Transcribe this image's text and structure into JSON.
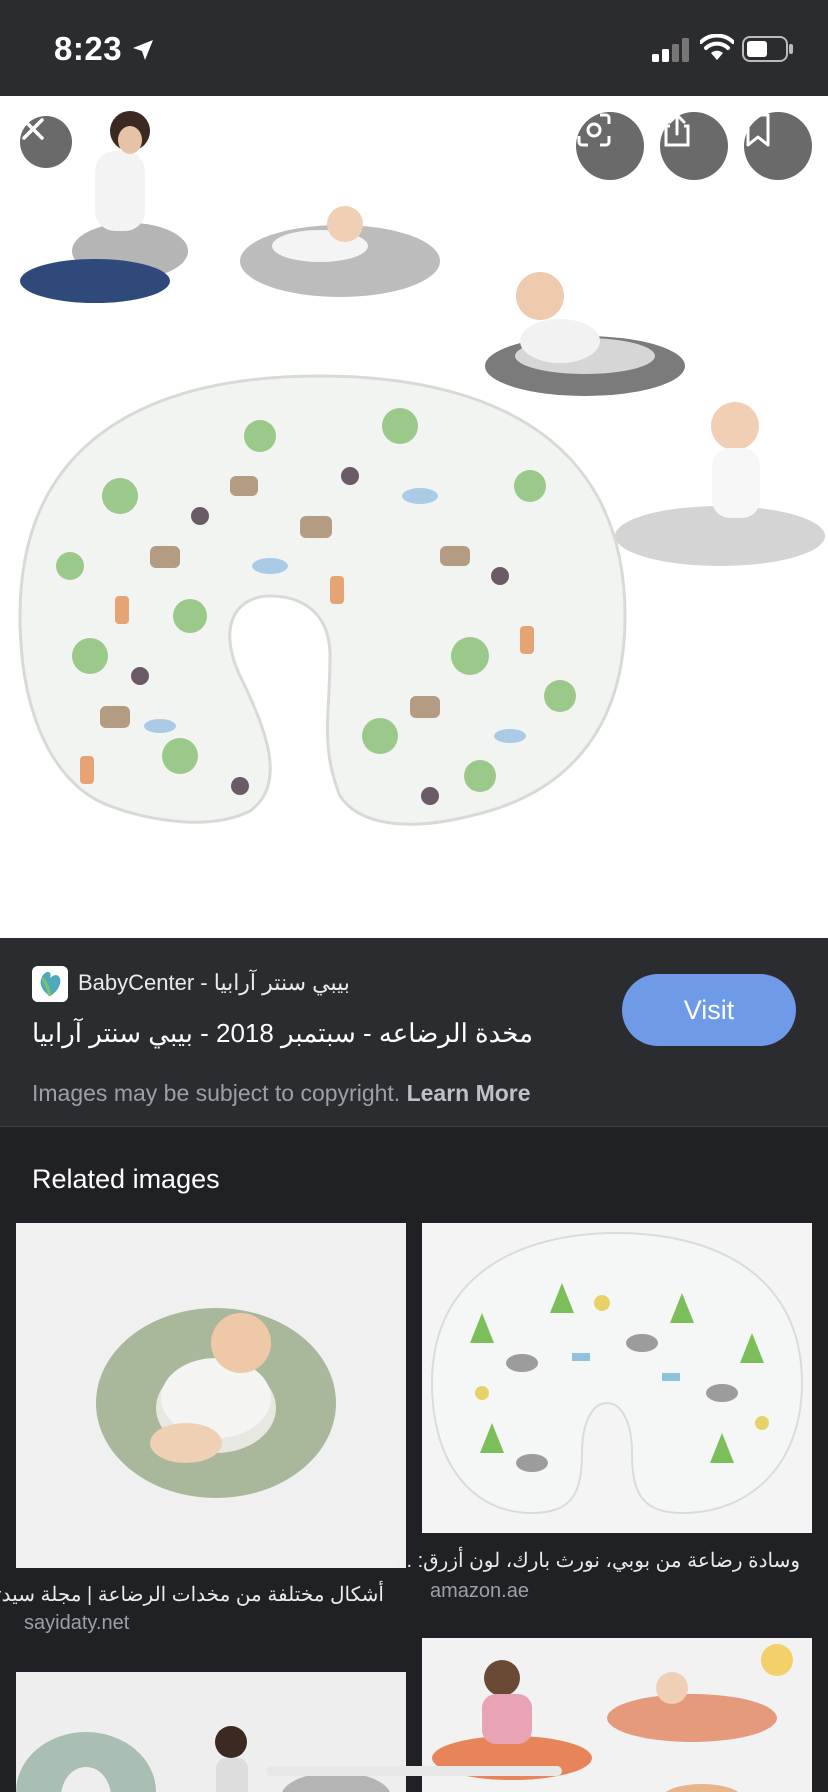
{
  "status_bar": {
    "time": "8:23"
  },
  "viewer": {
    "close_icon": "close-icon",
    "actions": [
      "lens-icon",
      "share-icon",
      "bookmark-icon"
    ]
  },
  "result": {
    "source": "BabyCenter - بيبي سنتر آرابيا",
    "title": "مخدة الرضاعه - سبتمبر 2018 - بيبي سنتر آرابيا",
    "visit_label": "Visit",
    "copyright_text": "Images may be subject to copyright.",
    "learn_more": "Learn More"
  },
  "related": {
    "heading": "Related images",
    "items": [
      {
        "caption": "أشكال مختلفة من مخدات الرضاعة | مجلة سيدتي",
        "domain": "sayidaty.net"
      },
      {
        "caption": "وسادة رضاعة من بوبي، نورث بارك، لون أزرق: ...",
        "domain": "amazon.ae"
      }
    ]
  },
  "colors": {
    "background": "#202124",
    "panel": "#2b2c2f",
    "visit_button": "#6f9ae8",
    "muted_text": "#9aa0a6"
  }
}
